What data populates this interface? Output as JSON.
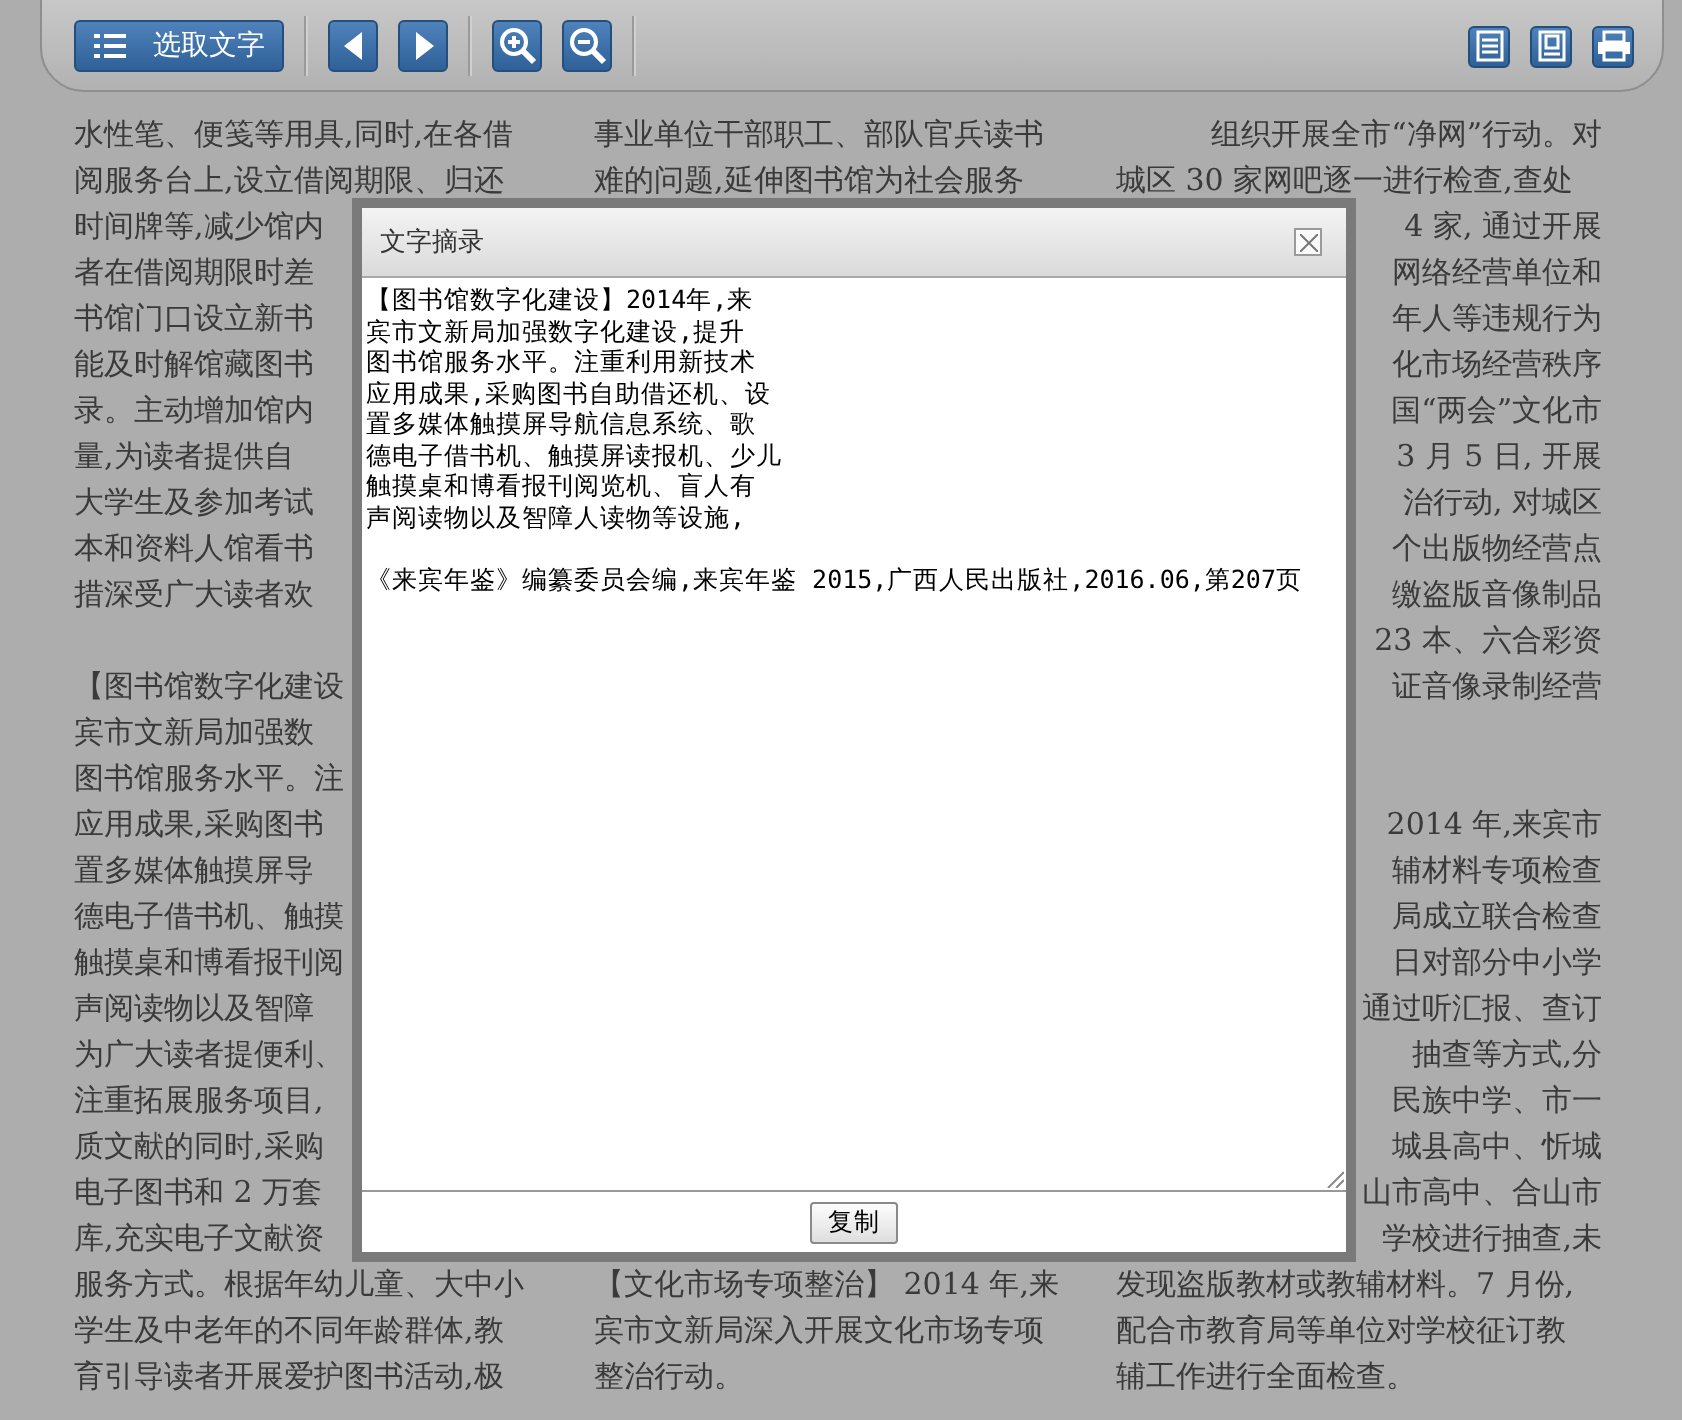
{
  "toolbar": {
    "select_text_button": "选取文字"
  },
  "columns": [
    {
      "blocks": [
        [
          "水性笔、便笺等用具,同时,在各借",
          "阅服务台上,设立借阅期限、归还",
          "时间牌等,减少馆内",
          "者在借阅期限时差",
          "书馆门口设立新书",
          "能及时解馆藏图书",
          "录。主动增加馆内",
          "量,为读者提供自",
          "大学生及参加考试",
          "本和资料人馆看书",
          "措深受广大读者欢"
        ],
        [
          "【图书馆数字化建设",
          "宾市文新局加强数",
          "图书馆服务水平。注",
          "应用成果,采购图书",
          "置多媒体触摸屏导",
          "德电子借书机、触摸",
          "触摸桌和博看报刊阅",
          "声阅读物以及智障",
          "为广大读者提便利、",
          "注重拓展服务项目,",
          "质文献的同时,采购",
          "电子图书和 2 万套",
          "库,充实电子文献资",
          "服务方式。根据年幼儿童、大中小",
          "学生及中老年的不同年龄群体,教",
          "育引导读者开展爱护图书活动,极"
        ]
      ]
    },
    {
      "blocks": [
        [
          "事业单位干部职工、部队官兵读书",
          "难的问题,延伸图书馆为社会服务"
        ],
        [
          "【文化市场专项整治】 2014 年,来",
          "宾市文新局深入开展文化市场专项",
          "整治行动。"
        ]
      ]
    },
    {
      "blocks": [
        [
          {
            "text": "组织开展全市“净网”行动。对",
            "kind": "tail"
          },
          {
            "text": "城区 30 家网吧逐一进行检查,查处",
            "kind": "whole"
          },
          {
            "text": "4 家, 通过开展",
            "kind": "tail"
          },
          {
            "text": "网络经营单位和",
            "kind": "tail"
          },
          {
            "text": "年人等违规行为",
            "kind": "tail"
          },
          {
            "text": "化市场经营秩序",
            "kind": "tail"
          },
          {
            "text": "国“两会”文化市",
            "kind": "tail"
          },
          {
            "text": "3 月 5 日, 开展",
            "kind": "tail"
          },
          {
            "text": "治行动, 对城区",
            "kind": "tail"
          },
          {
            "text": "个出版物经营点",
            "kind": "tail"
          },
          {
            "text": "缴盗版音像制品",
            "kind": "tail"
          },
          {
            "text": "23 本、六合彩资",
            "kind": "tail"
          },
          {
            "text": "证音像录制经营",
            "kind": "tail"
          }
        ],
        [
          {
            "text": "2014 年,来宾市",
            "kind": "tail"
          },
          {
            "text": "辅材料专项检查",
            "kind": "tail"
          },
          {
            "text": "局成立联合检查",
            "kind": "tail"
          },
          {
            "text": "日对部分中小学",
            "kind": "tail"
          },
          {
            "text": "通过听汇报、查订",
            "kind": "tail"
          },
          {
            "text": "抽查等方式,分",
            "kind": "tail"
          },
          {
            "text": "民族中学、市一",
            "kind": "tail"
          },
          {
            "text": "城县高中、忻城",
            "kind": "tail"
          },
          {
            "text": "山市高中、合山市",
            "kind": "tail"
          },
          {
            "text": "学校进行抽查,未",
            "kind": "tail"
          },
          {
            "text": "发现盗版教材或教辅材料。7 月份,",
            "kind": "whole"
          },
          {
            "text": "配合市教育局等单位对学校征订教",
            "kind": "whole"
          },
          {
            "text": "辅工作进行全面检查。",
            "kind": "whole"
          }
        ]
      ]
    }
  ],
  "dialog": {
    "title": "文字摘录",
    "text_lines": [
      "【图书馆数字化建设】2014年,来",
      "宾市文新局加强数字化建设,提升",
      "图书馆服务水平。注重利用新技术",
      "应用成果,采购图书自助借还机、设",
      "置多媒体触摸屏导航信息系统、歌",
      "德电子借书机、触摸屏读报机、少儿",
      "触摸桌和博看报刊阅览机、盲人有",
      "声阅读物以及智障人读物等设施,"
    ],
    "citation": "《来宾年鉴》编纂委员会编,来宾年鉴  2015,广西人民出版社,2016.06,第207页",
    "copy_button": "复制"
  }
}
